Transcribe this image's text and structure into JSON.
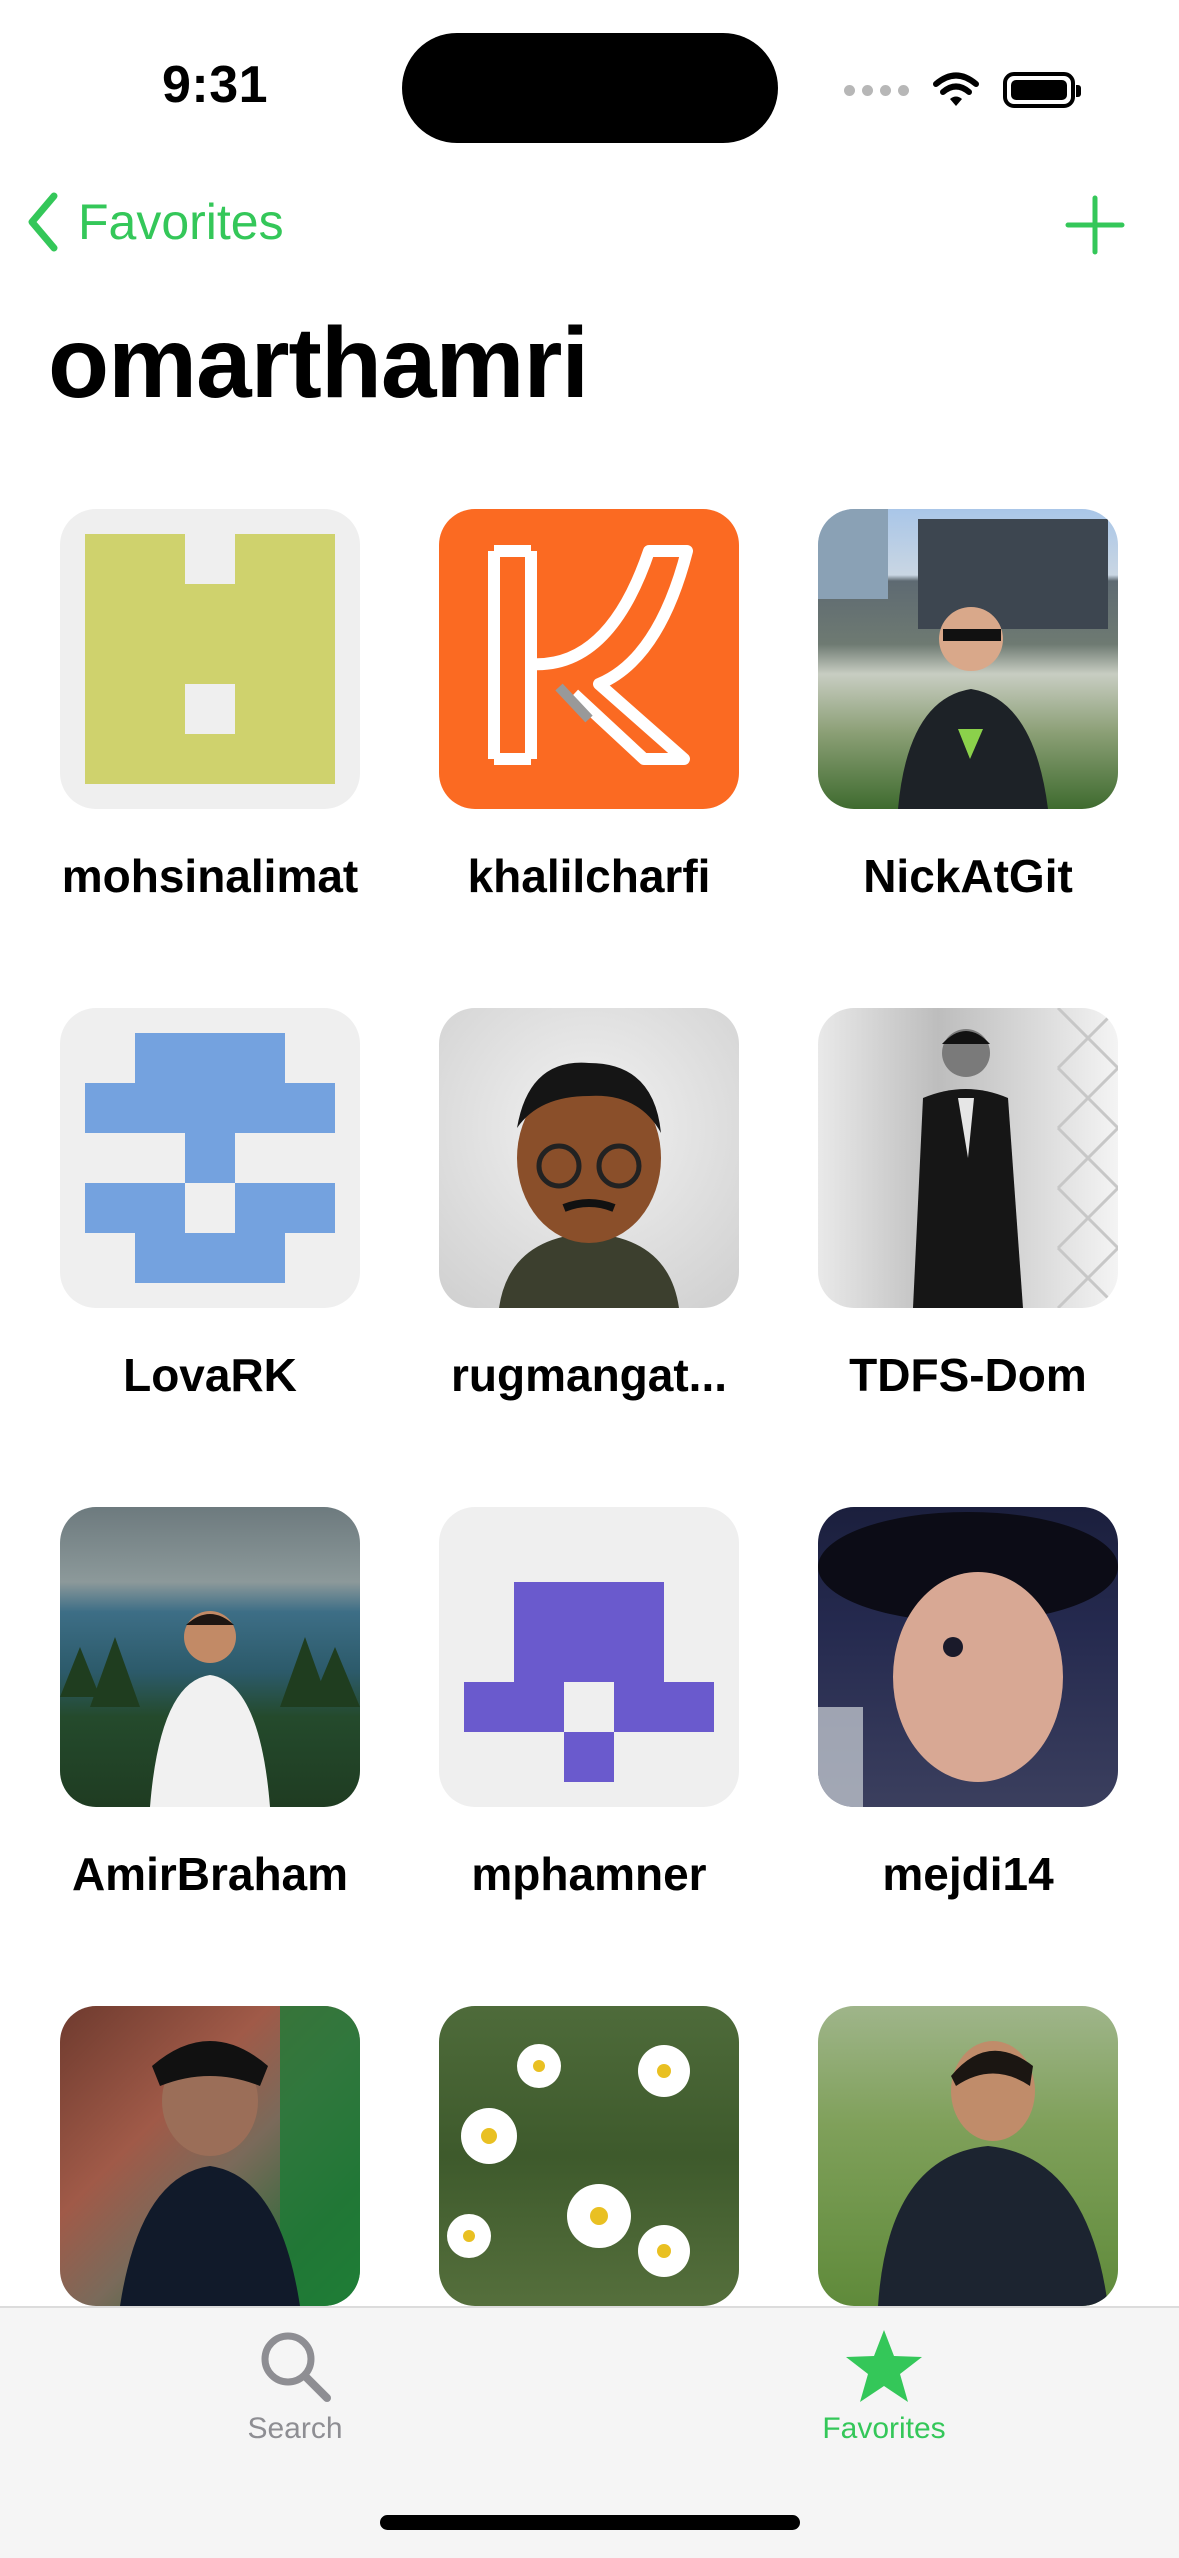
{
  "status_bar": {
    "time": "9:31"
  },
  "nav": {
    "back_label": "Favorites"
  },
  "page_title": "omarthamri",
  "users": [
    {
      "name": "mohsinalimat",
      "avatar": "identicon-green-icon"
    },
    {
      "name": "khalilcharfi",
      "avatar": "k-logo-icon"
    },
    {
      "name": "NickAtGit",
      "avatar": "photo-icon"
    },
    {
      "name": "LovaRK",
      "avatar": "identicon-blue-icon"
    },
    {
      "name": "rugmangat...",
      "avatar": "memoji-icon"
    },
    {
      "name": "TDFS-Dom",
      "avatar": "photo-icon"
    },
    {
      "name": "AmirBraham",
      "avatar": "photo-icon"
    },
    {
      "name": "mphamner",
      "avatar": "identicon-purple-icon"
    },
    {
      "name": "mejdi14",
      "avatar": "photo-icon"
    },
    {
      "name": "",
      "avatar": "photo-icon"
    },
    {
      "name": "",
      "avatar": "photo-icon"
    },
    {
      "name": "",
      "avatar": "photo-icon"
    }
  ],
  "tabs": {
    "search_label": "Search",
    "favorites_label": "Favorites"
  },
  "colors": {
    "accent": "#34c759",
    "inactive": "#8e8e93"
  }
}
